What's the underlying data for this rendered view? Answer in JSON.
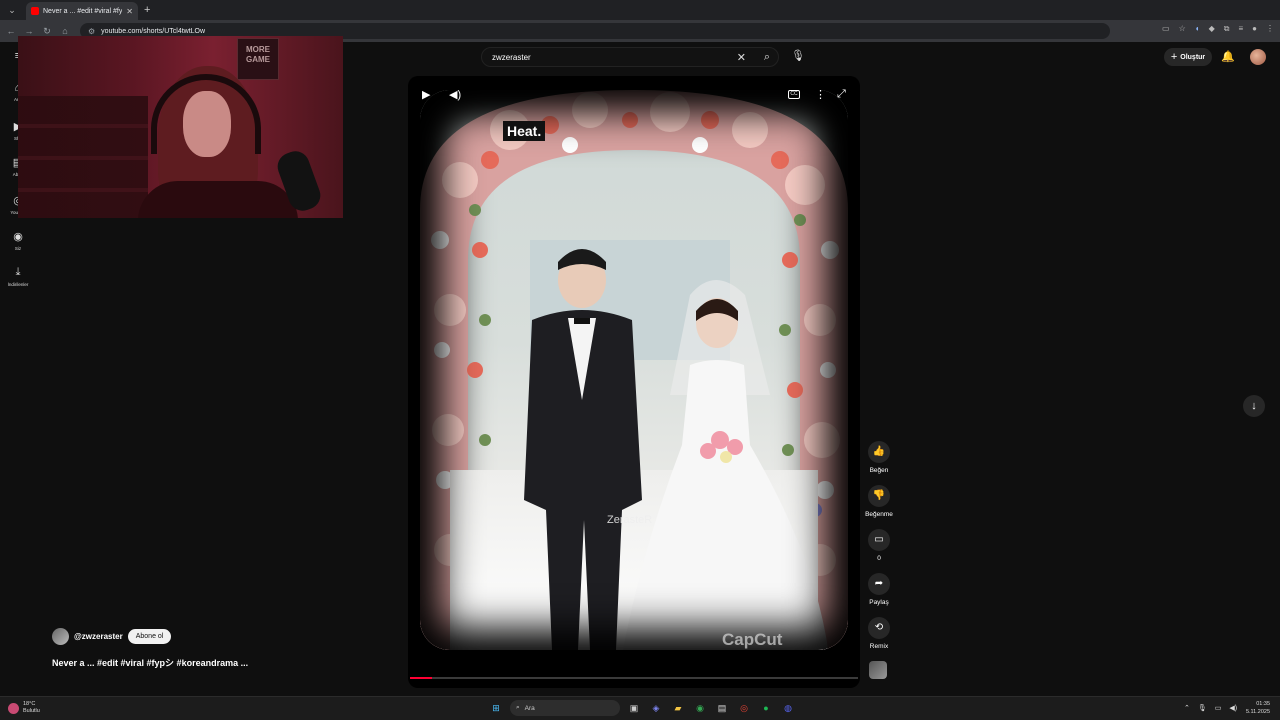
{
  "browser": {
    "tab_title": "Never a ... #edit #viral #fypシ #k",
    "url": "youtube.com/shorts/UTcl4twtLOw"
  },
  "youtube": {
    "search_value": "zwzeraster",
    "create_label": "Oluştur",
    "sidebar": [
      {
        "label": "Ana"
      },
      {
        "label": "Sho"
      },
      {
        "label": "Abon"
      },
      {
        "label": "YouTub"
      },
      {
        "label": "Siz"
      },
      {
        "label": "İndirilenler"
      }
    ]
  },
  "webcam": {
    "poster_text": "MORE GAME"
  },
  "player": {
    "caption_overlay": "Heat.",
    "watermark": "ZerasteR",
    "capcut_logo": "CapCut",
    "progress_percent": 5
  },
  "actions": {
    "like_label": "Beğen",
    "dislike_label": "Beğenme",
    "comments_count": "0",
    "share_label": "Paylaş",
    "remix_label": "Remix"
  },
  "channel": {
    "handle": "@zwzeraster",
    "subscribe_label": "Abone ol",
    "video_title": "Never a ... #edit #viral #fypシ #koreandrama ..."
  },
  "taskbar": {
    "temperature": "18°C",
    "weather": "Bulutlu",
    "search_placeholder": "Ara",
    "time": "01:35",
    "date": "5.11.2025"
  }
}
